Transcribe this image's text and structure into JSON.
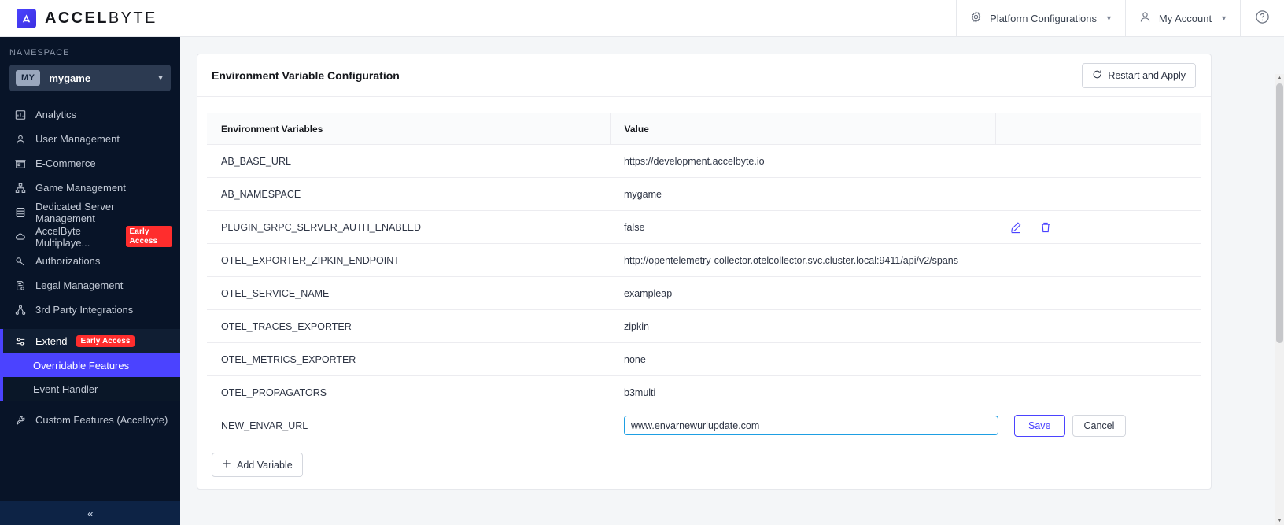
{
  "header": {
    "brand_prefix": "ACCEL",
    "brand_suffix": "BYTE",
    "platform_config_label": "Platform Configurations",
    "account_label": "My Account",
    "help_label": "?"
  },
  "sidebar": {
    "namespace_label": "NAMESPACE",
    "namespace_badge": "MY",
    "namespace_value": "mygame",
    "items": [
      {
        "label": "Analytics",
        "icon": "bar-chart-icon",
        "badge": null
      },
      {
        "label": "User Management",
        "icon": "user-icon",
        "badge": null
      },
      {
        "label": "E-Commerce",
        "icon": "store-icon",
        "badge": null
      },
      {
        "label": "Game Management",
        "icon": "sitemap-icon",
        "badge": null
      },
      {
        "label": "Dedicated Server Management",
        "icon": "server-icon",
        "badge": null
      },
      {
        "label": "AccelByte Multiplaye...",
        "icon": "cloud-icon",
        "badge": "Early Access"
      },
      {
        "label": "Authorizations",
        "icon": "key-icon",
        "badge": null
      },
      {
        "label": "Legal Management",
        "icon": "document-icon",
        "badge": null
      },
      {
        "label": "3rd Party Integrations",
        "icon": "share-nodes-icon",
        "badge": null
      }
    ],
    "extend": {
      "label": "Extend",
      "icon": "sliders-icon",
      "badge": "Early Access",
      "children": [
        {
          "label": "Overridable Features",
          "active": true
        },
        {
          "label": "Event Handler",
          "active": false
        }
      ]
    },
    "custom_features": {
      "label": "Custom Features (Accelbyte)",
      "icon": "wrench-icon"
    },
    "collapse_label": "«"
  },
  "main": {
    "card_title": "Environment Variable Configuration",
    "restart_button": "Restart and Apply",
    "restart_icon": "refresh-icon",
    "add_button": "Add Variable",
    "add_icon": "plus-icon",
    "columns": [
      "Environment Variables",
      "Value"
    ],
    "rows": [
      {
        "name": "AB_BASE_URL",
        "value": "https://development.accelbyte.io",
        "mode": "static",
        "show_actions": false
      },
      {
        "name": "AB_NAMESPACE",
        "value": "mygame",
        "mode": "static",
        "show_actions": false
      },
      {
        "name": "PLUGIN_GRPC_SERVER_AUTH_ENABLED",
        "value": "false",
        "mode": "static",
        "show_actions": true
      },
      {
        "name": "OTEL_EXPORTER_ZIPKIN_ENDPOINT",
        "value": "http://opentelemetry-collector.otelcollector.svc.cluster.local:9411/api/v2/spans",
        "mode": "static",
        "show_actions": false
      },
      {
        "name": "OTEL_SERVICE_NAME",
        "value": "exampleap",
        "mode": "static",
        "show_actions": false
      },
      {
        "name": "OTEL_TRACES_EXPORTER",
        "value": "zipkin",
        "mode": "static",
        "show_actions": false
      },
      {
        "name": "OTEL_METRICS_EXPORTER",
        "value": "none",
        "mode": "static",
        "show_actions": false
      },
      {
        "name": "OTEL_PROPAGATORS",
        "value": "b3multi",
        "mode": "static",
        "show_actions": false
      },
      {
        "name": "NEW_ENVAR_URL",
        "value": "www.envarnewurlupdate.com",
        "mode": "editing",
        "show_actions": false
      }
    ],
    "edit_row": {
      "save_label": "Save",
      "cancel_label": "Cancel",
      "input_placeholder": ""
    },
    "row_action_icons": {
      "edit": "pencil-icon",
      "delete": "trash-icon"
    }
  },
  "colors": {
    "accent": "#4b43ff",
    "sidebar_bg": "#081428",
    "badge_red": "#ff2d2d",
    "input_focus": "#1e9fe3"
  }
}
